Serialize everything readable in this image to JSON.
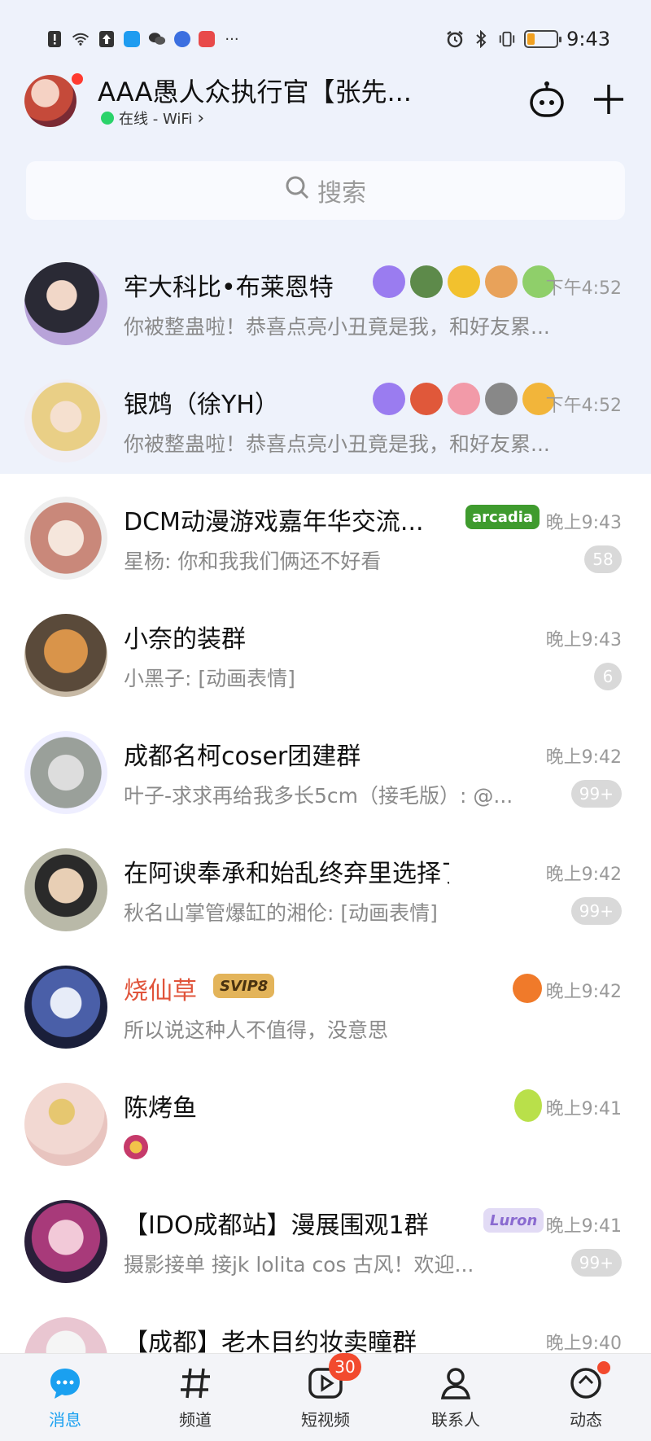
{
  "status_bar": {
    "time": "9:43",
    "battery_level": 0.25,
    "icons": [
      "sim-alert-icon",
      "wifi-icon",
      "upload-icon",
      "alipay-icon",
      "wechat-icon",
      "music-icon",
      "reader-icon",
      "more-dots-icon",
      "alarm-icon",
      "bluetooth-icon",
      "vibrate-icon",
      "battery-icon"
    ],
    "more": "···"
  },
  "header": {
    "name": "AAA愚人众执行官【张先...",
    "status": "在线 - WiFi",
    "status_chevron": "›"
  },
  "search": {
    "placeholder": "搜索"
  },
  "chats": [
    {
      "name": "牢大科比•布莱恩特",
      "message": "你被整蛊啦！恭喜点亮小丑竟是我，和好友累...",
      "time": "下午4:52",
      "badge": "",
      "pinned": true,
      "name_color": "#111111"
    },
    {
      "name": "银鸩（徐YH）",
      "message": "你被整蛊啦！恭喜点亮小丑竟是我，和好友累...",
      "time": "下午4:52",
      "badge": "",
      "pinned": true,
      "name_color": "#111111"
    },
    {
      "name": "DCM动漫游戏嘉年华交流...",
      "message": "星杨: 你和我我们俩还不好看",
      "time": "晚上9:43",
      "badge": "58",
      "tag": "arcadia",
      "name_color": "#111111"
    },
    {
      "name": "小奈的装群",
      "message": "小黑子: [动画表情]",
      "time": "晚上9:43",
      "badge": "6",
      "name_color": "#111111"
    },
    {
      "name": "成都名柯coser团建群",
      "message": "叶子-求求再给我多长5cm（接毛版）: @...",
      "time": "晚上9:42",
      "badge": "99+",
      "name_color": "#111111"
    },
    {
      "name": "在阿谀奉承和始乱终弃里选择了...",
      "message": "秋名山掌管爆缸的湘伦: [动画表情]",
      "time": "晚上9:42",
      "badge": "99+",
      "name_color": "#111111"
    },
    {
      "name": "烧仙草",
      "message": "所以说这种人不值得，没意思",
      "time": "晚上9:42",
      "badge": "",
      "tag": "SVIP8",
      "name_color": "#e0533a"
    },
    {
      "name": "陈烤鱼",
      "message": "",
      "time": "晚上9:41",
      "badge": "",
      "name_color": "#111111"
    },
    {
      "name": "【IDO成都站】漫展围观1群",
      "message": "摄影接单 接jk      lolita cos 古风！欢迎...",
      "time": "晚上9:41",
      "badge": "99+",
      "tag": "Luron",
      "name_color": "#111111"
    },
    {
      "name": "【成都】老木目约妆卖瞳群",
      "message": "",
      "time": "晚上9:40",
      "badge": "",
      "name_color": "#111111"
    }
  ],
  "bottom_nav": [
    {
      "label": "消息",
      "active": true
    },
    {
      "label": "频道",
      "active": false
    },
    {
      "label": "短视频",
      "active": false,
      "badge": "30"
    },
    {
      "label": "联系人",
      "active": false
    },
    {
      "label": "动态",
      "active": false,
      "dot": true
    }
  ],
  "colors": {
    "accent": "#1aa0f0",
    "badge_red": "#f24a2e",
    "pinned_bg": "#eef2fb"
  }
}
